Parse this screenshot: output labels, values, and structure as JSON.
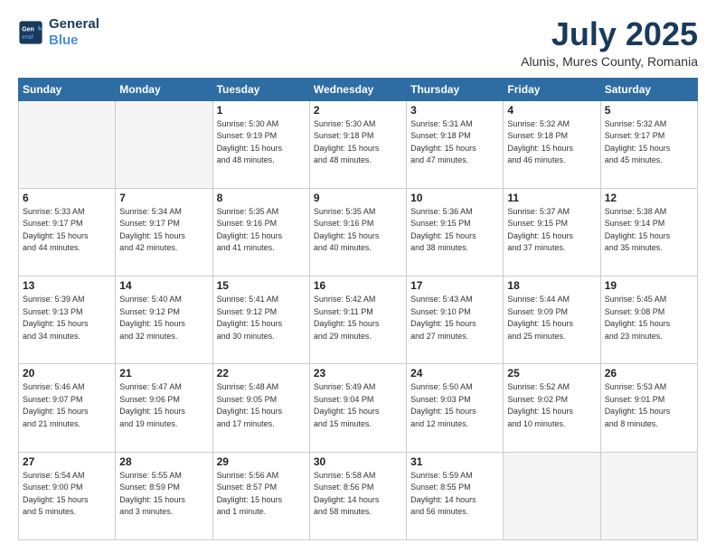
{
  "header": {
    "logo_line1": "General",
    "logo_line2": "Blue",
    "title": "July 2025",
    "subtitle": "Alunis, Mures County, Romania"
  },
  "weekdays": [
    "Sunday",
    "Monday",
    "Tuesday",
    "Wednesday",
    "Thursday",
    "Friday",
    "Saturday"
  ],
  "weeks": [
    [
      {
        "day": "",
        "info": ""
      },
      {
        "day": "",
        "info": ""
      },
      {
        "day": "1",
        "info": "Sunrise: 5:30 AM\nSunset: 9:19 PM\nDaylight: 15 hours\nand 48 minutes."
      },
      {
        "day": "2",
        "info": "Sunrise: 5:30 AM\nSunset: 9:18 PM\nDaylight: 15 hours\nand 48 minutes."
      },
      {
        "day": "3",
        "info": "Sunrise: 5:31 AM\nSunset: 9:18 PM\nDaylight: 15 hours\nand 47 minutes."
      },
      {
        "day": "4",
        "info": "Sunrise: 5:32 AM\nSunset: 9:18 PM\nDaylight: 15 hours\nand 46 minutes."
      },
      {
        "day": "5",
        "info": "Sunrise: 5:32 AM\nSunset: 9:17 PM\nDaylight: 15 hours\nand 45 minutes."
      }
    ],
    [
      {
        "day": "6",
        "info": "Sunrise: 5:33 AM\nSunset: 9:17 PM\nDaylight: 15 hours\nand 44 minutes."
      },
      {
        "day": "7",
        "info": "Sunrise: 5:34 AM\nSunset: 9:17 PM\nDaylight: 15 hours\nand 42 minutes."
      },
      {
        "day": "8",
        "info": "Sunrise: 5:35 AM\nSunset: 9:16 PM\nDaylight: 15 hours\nand 41 minutes."
      },
      {
        "day": "9",
        "info": "Sunrise: 5:35 AM\nSunset: 9:16 PM\nDaylight: 15 hours\nand 40 minutes."
      },
      {
        "day": "10",
        "info": "Sunrise: 5:36 AM\nSunset: 9:15 PM\nDaylight: 15 hours\nand 38 minutes."
      },
      {
        "day": "11",
        "info": "Sunrise: 5:37 AM\nSunset: 9:15 PM\nDaylight: 15 hours\nand 37 minutes."
      },
      {
        "day": "12",
        "info": "Sunrise: 5:38 AM\nSunset: 9:14 PM\nDaylight: 15 hours\nand 35 minutes."
      }
    ],
    [
      {
        "day": "13",
        "info": "Sunrise: 5:39 AM\nSunset: 9:13 PM\nDaylight: 15 hours\nand 34 minutes."
      },
      {
        "day": "14",
        "info": "Sunrise: 5:40 AM\nSunset: 9:12 PM\nDaylight: 15 hours\nand 32 minutes."
      },
      {
        "day": "15",
        "info": "Sunrise: 5:41 AM\nSunset: 9:12 PM\nDaylight: 15 hours\nand 30 minutes."
      },
      {
        "day": "16",
        "info": "Sunrise: 5:42 AM\nSunset: 9:11 PM\nDaylight: 15 hours\nand 29 minutes."
      },
      {
        "day": "17",
        "info": "Sunrise: 5:43 AM\nSunset: 9:10 PM\nDaylight: 15 hours\nand 27 minutes."
      },
      {
        "day": "18",
        "info": "Sunrise: 5:44 AM\nSunset: 9:09 PM\nDaylight: 15 hours\nand 25 minutes."
      },
      {
        "day": "19",
        "info": "Sunrise: 5:45 AM\nSunset: 9:08 PM\nDaylight: 15 hours\nand 23 minutes."
      }
    ],
    [
      {
        "day": "20",
        "info": "Sunrise: 5:46 AM\nSunset: 9:07 PM\nDaylight: 15 hours\nand 21 minutes."
      },
      {
        "day": "21",
        "info": "Sunrise: 5:47 AM\nSunset: 9:06 PM\nDaylight: 15 hours\nand 19 minutes."
      },
      {
        "day": "22",
        "info": "Sunrise: 5:48 AM\nSunset: 9:05 PM\nDaylight: 15 hours\nand 17 minutes."
      },
      {
        "day": "23",
        "info": "Sunrise: 5:49 AM\nSunset: 9:04 PM\nDaylight: 15 hours\nand 15 minutes."
      },
      {
        "day": "24",
        "info": "Sunrise: 5:50 AM\nSunset: 9:03 PM\nDaylight: 15 hours\nand 12 minutes."
      },
      {
        "day": "25",
        "info": "Sunrise: 5:52 AM\nSunset: 9:02 PM\nDaylight: 15 hours\nand 10 minutes."
      },
      {
        "day": "26",
        "info": "Sunrise: 5:53 AM\nSunset: 9:01 PM\nDaylight: 15 hours\nand 8 minutes."
      }
    ],
    [
      {
        "day": "27",
        "info": "Sunrise: 5:54 AM\nSunset: 9:00 PM\nDaylight: 15 hours\nand 5 minutes."
      },
      {
        "day": "28",
        "info": "Sunrise: 5:55 AM\nSunset: 8:59 PM\nDaylight: 15 hours\nand 3 minutes."
      },
      {
        "day": "29",
        "info": "Sunrise: 5:56 AM\nSunset: 8:57 PM\nDaylight: 15 hours\nand 1 minute."
      },
      {
        "day": "30",
        "info": "Sunrise: 5:58 AM\nSunset: 8:56 PM\nDaylight: 14 hours\nand 58 minutes."
      },
      {
        "day": "31",
        "info": "Sunrise: 5:59 AM\nSunset: 8:55 PM\nDaylight: 14 hours\nand 56 minutes."
      },
      {
        "day": "",
        "info": ""
      },
      {
        "day": "",
        "info": ""
      }
    ]
  ]
}
